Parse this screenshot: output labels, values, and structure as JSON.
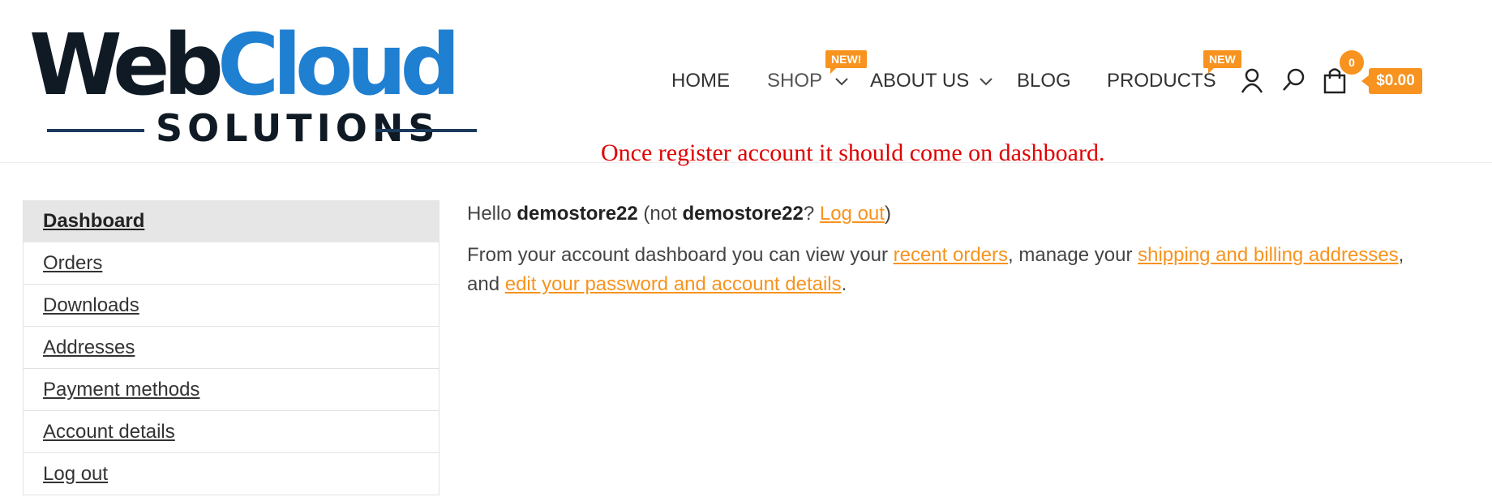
{
  "logo": {
    "part1": "Web",
    "part2": "Cloud",
    "tagline": "SOLUTIONS"
  },
  "nav": {
    "home": "HOME",
    "shop": "SHOP",
    "shop_badge": "NEW!",
    "about": "ABOUT US",
    "blog": "BLOG",
    "products": "PRODUCTS",
    "products_badge": "NEW"
  },
  "icons": {
    "account": "user-icon",
    "search": "search-icon",
    "cart": "bag-icon",
    "chevron": "chevron-down-icon"
  },
  "cart": {
    "count": "0",
    "total": "$0.00"
  },
  "annotation": "Once register account it should come on dashboard.",
  "sidebar": {
    "items": [
      {
        "label": "Dashboard",
        "active": true
      },
      {
        "label": "Orders"
      },
      {
        "label": "Downloads"
      },
      {
        "label": "Addresses"
      },
      {
        "label": "Payment methods"
      },
      {
        "label": "Account details"
      },
      {
        "label": "Log out"
      }
    ]
  },
  "content": {
    "hello": "Hello ",
    "username": "demostore22",
    "not_open": " (not ",
    "username2": "demostore22",
    "question": "? ",
    "logout": "Log out",
    "close": ")",
    "intro": "From your account dashboard you can view your ",
    "recent_orders": "recent orders",
    "mid": ", manage your ",
    "addresses": "shipping and billing addresses",
    "and": ", and ",
    "edit": "edit your password and account details",
    "end": "."
  },
  "colors": {
    "accent": "#f7931e",
    "logo_blue": "#1f7fd1",
    "logo_dark": "#0f1a24",
    "annotation": "#e00000",
    "active_bg": "#e6e6e6"
  }
}
